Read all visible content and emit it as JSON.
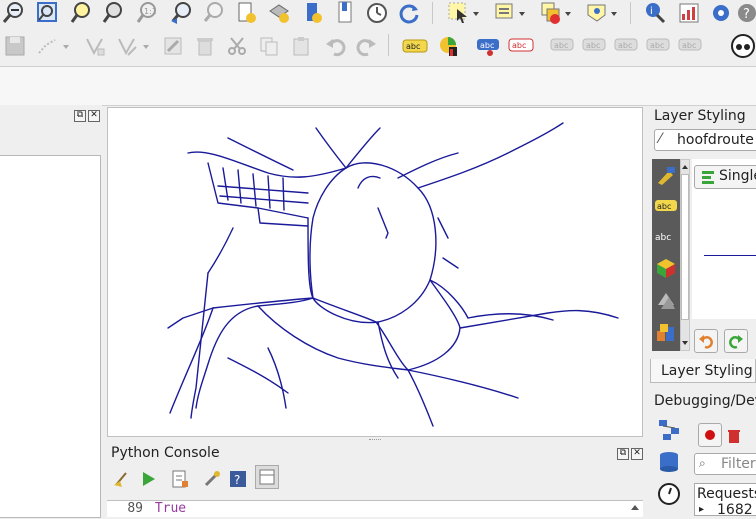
{
  "layer_styling": {
    "title": "Layer Styling",
    "layer_name": "hoofdroute",
    "renderer": "Single",
    "tab_label": "Layer Styling"
  },
  "debugging": {
    "title": "Debugging/Dev",
    "filter_placeholder": "Filter",
    "requests_label": "Requests",
    "request_row": "1682"
  },
  "python_console": {
    "title": "Python Console",
    "line_number": "89",
    "line_text": "True"
  },
  "colors": {
    "road": "#1a1a9a",
    "panel_bg": "#efefef",
    "accent_blue": "#3a6ec8"
  }
}
